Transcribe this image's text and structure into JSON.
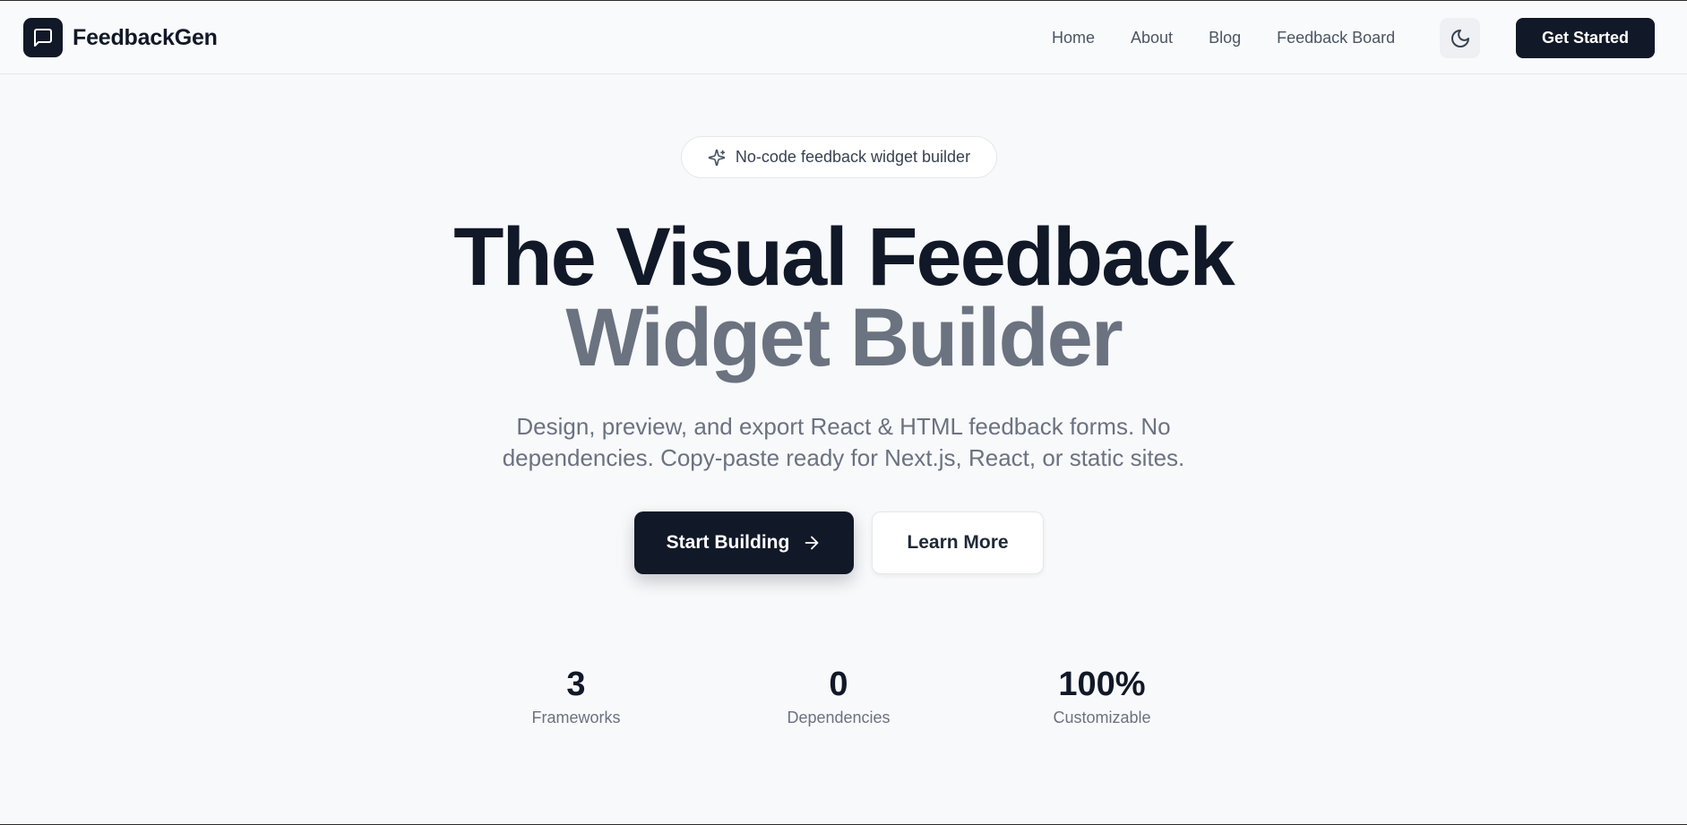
{
  "header": {
    "brand": "FeedbackGen",
    "nav": [
      "Home",
      "About",
      "Blog",
      "Feedback Board"
    ],
    "cta": "Get Started",
    "theme_icon": "moon-icon",
    "logo_icon": "message-square-icon"
  },
  "hero": {
    "badge_text": "No-code feedback widget builder",
    "badge_icon": "sparkles-icon",
    "title_line1": "The Visual Feedback",
    "title_line2": "Widget Builder",
    "subtitle_line1": "Design, preview, and export React & HTML feedback forms. No",
    "subtitle_line2": "dependencies. Copy-paste ready for Next.js, React, or static sites.",
    "primary_button": "Start Building",
    "primary_icon": "arrow-right-icon",
    "secondary_button": "Learn More"
  },
  "stats": [
    {
      "value": "3",
      "label": "Frameworks"
    },
    {
      "value": "0",
      "label": "Dependencies"
    },
    {
      "value": "100%",
      "label": "Customizable"
    }
  ],
  "colors": {
    "primary": "#111827",
    "muted_text": "#6b7280",
    "background": "#f8f9fb"
  }
}
